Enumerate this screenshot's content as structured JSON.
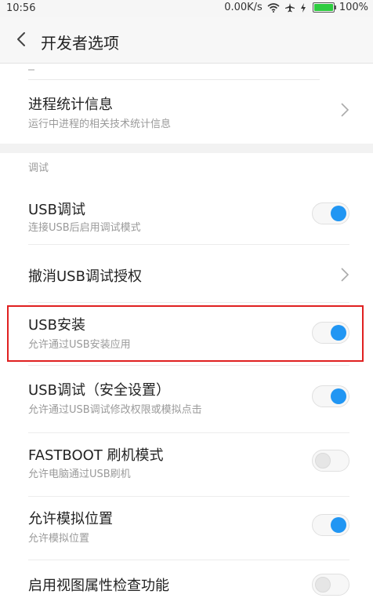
{
  "status": {
    "time": "10:56",
    "net_speed": "0.00K/s",
    "battery": "100%",
    "battery_level": 1.0
  },
  "header": {
    "title": "开发者选项"
  },
  "items": [
    {
      "title": "进程统计信息",
      "subtitle": "运行中进程的相关技术统计信息",
      "control": "chevron"
    },
    {
      "section": "调试"
    },
    {
      "title": "USB调试",
      "subtitle": "连接USB后启用调试模式",
      "control": "toggle",
      "on": true
    },
    {
      "title": "撤消USB调试授权",
      "control": "chevron"
    },
    {
      "title": "USB安装",
      "subtitle": "允许通过USB安装应用",
      "control": "toggle",
      "on": true
    },
    {
      "title": "USB调试（安全设置）",
      "subtitle": "允许通过USB调试修改权限或模拟点击",
      "control": "toggle",
      "on": true
    },
    {
      "title": "FASTBOOT 刷机模式",
      "subtitle": "允许电脑通过USB刷机",
      "control": "toggle",
      "on": false
    },
    {
      "title": "允许模拟位置",
      "subtitle": "允许模拟位置",
      "control": "toggle",
      "on": true
    },
    {
      "title": "启用视图属性检查功能",
      "control": "toggle",
      "on": false
    }
  ]
}
